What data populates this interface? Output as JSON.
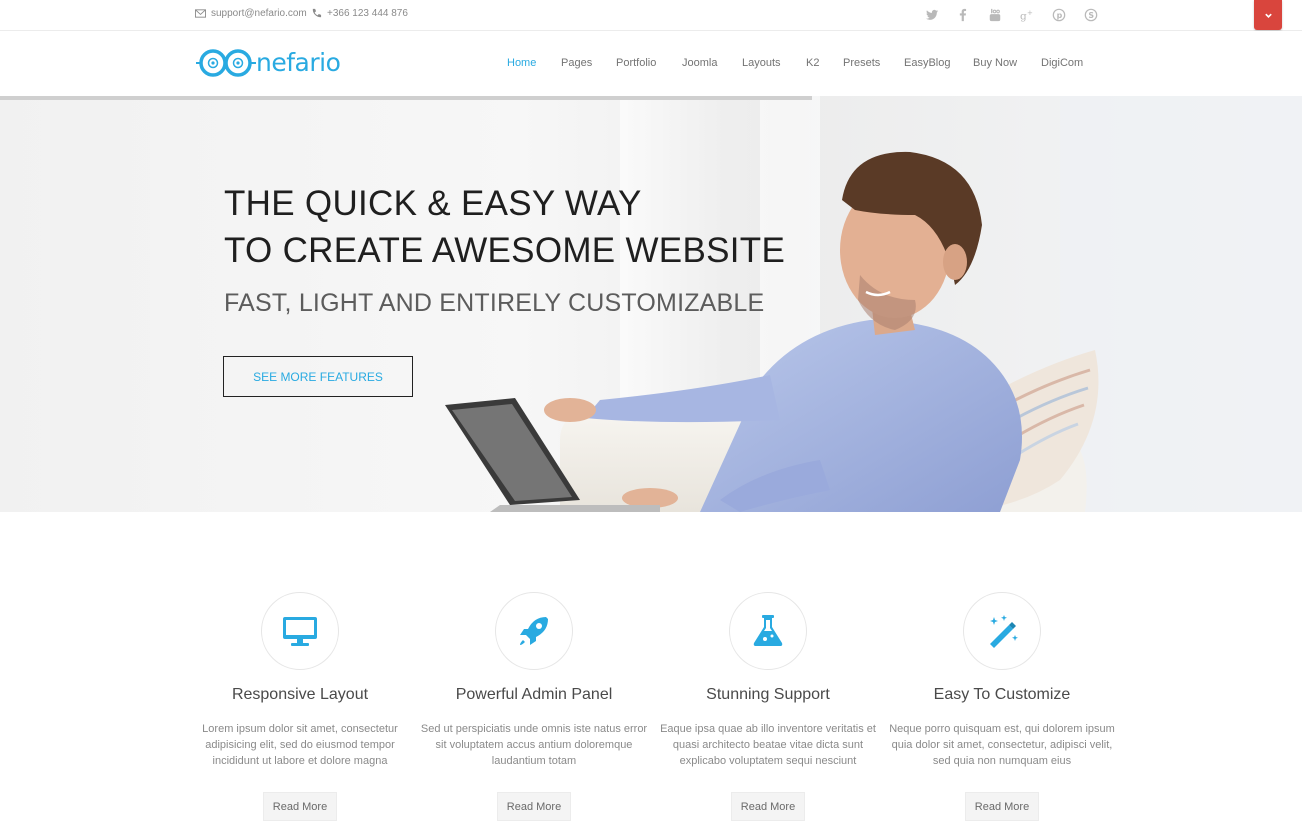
{
  "topbar": {
    "email": "support@nefario.com",
    "phone": "+366 123 444 876",
    "social_icons": [
      "twitter-icon",
      "facebook-icon",
      "youtube-icon",
      "google-plus-icon",
      "pinterest-icon",
      "skype-icon"
    ],
    "toggle_icon": "chevron-down-icon"
  },
  "header": {
    "logo_text": "nefario",
    "nav": [
      "Home",
      "Pages",
      "Portfolio",
      "Joomla",
      "Layouts",
      "K2",
      "Presets",
      "EasyBlog",
      "Buy Now",
      "DigiCom"
    ],
    "active_nav": "Home"
  },
  "hero": {
    "title_line1": "THE QUICK & EASY WAY",
    "title_line2": "TO CREATE AWESOME WEBSITE",
    "subtitle": "FAST, LIGHT AND ENTIRELY CUSTOMIZABLE",
    "button_label": "SEE MORE FEATURES"
  },
  "features": [
    {
      "icon": "desktop-icon",
      "title": "Responsive Layout",
      "text": "Lorem ipsum dolor sit amet, consectetur adipisicing elit, sed do eiusmod tempor incididunt ut labore et dolore magna",
      "button": "Read More"
    },
    {
      "icon": "rocket-icon",
      "title": "Powerful Admin Panel",
      "text": "Sed ut perspiciatis unde omnis iste natus error sit voluptatem accus antium doloremque laudantium totam",
      "button": "Read More"
    },
    {
      "icon": "flask-icon",
      "title": "Stunning Support",
      "text": "Eaque ipsa quae ab illo inventore veritatis et quasi architecto beatae vitae dicta sunt explicabo voluptatem sequi nesciunt",
      "button": "Read More"
    },
    {
      "icon": "magic-wand-icon",
      "title": "Easy To Customize",
      "text": "Neque porro quisquam est, qui dolorem ipsum quia dolor sit amet, consectetur, adipisci velit, sed quia non numquam eius",
      "button": "Read More"
    }
  ],
  "colors": {
    "accent": "#29aae1",
    "toggle": "#d9453d",
    "hero_title": "#1f1f1f"
  }
}
